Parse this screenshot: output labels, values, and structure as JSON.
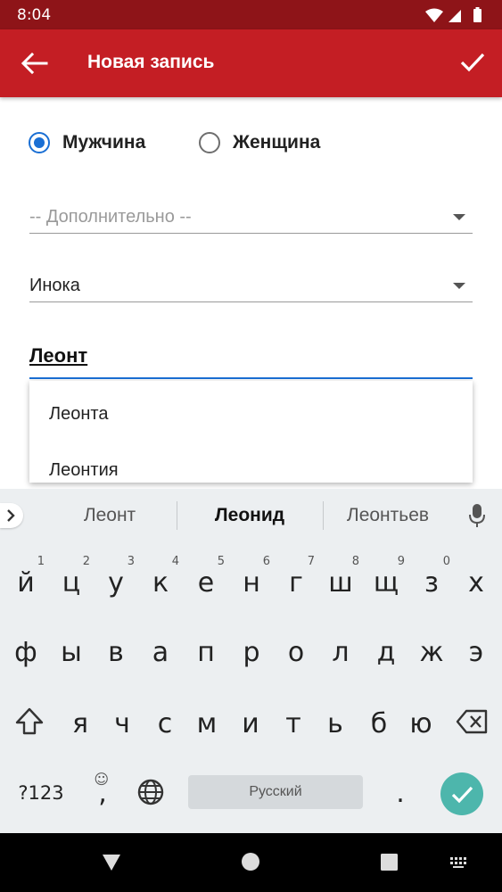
{
  "status": {
    "time": "8:04"
  },
  "toolbar": {
    "title": "Новая запись"
  },
  "gender": {
    "male": "Мужчина",
    "female": "Женщина",
    "selected": "male"
  },
  "fields": {
    "extra_placeholder": "-- Дополнительно --",
    "status_value": "Инока",
    "name_value": "Леонт"
  },
  "dropdown": {
    "items": [
      "Леонта",
      "Леонтия"
    ]
  },
  "keyboard": {
    "suggestions": [
      "Леонт",
      "Леонид",
      "Леонтьев"
    ],
    "row1": [
      "й",
      "ц",
      "у",
      "к",
      "е",
      "н",
      "г",
      "ш",
      "щ",
      "з",
      "х"
    ],
    "row1_hints": [
      "1",
      "2",
      "3",
      "4",
      "5",
      "6",
      "7",
      "8",
      "9",
      "0",
      ""
    ],
    "row2": [
      "ф",
      "ы",
      "в",
      "а",
      "п",
      "р",
      "о",
      "л",
      "д",
      "ж",
      "э"
    ],
    "row3": [
      "я",
      "ч",
      "с",
      "м",
      "и",
      "т",
      "ь",
      "б",
      "ю"
    ],
    "symbols_label": "?123",
    "comma": ",",
    "emoji_hint": "☺",
    "space_label": "Русский",
    "period": "."
  },
  "colors": {
    "accent": "#c41e24",
    "status_bar": "#8e1418",
    "input_focus": "#1a6fd4",
    "enter": "#4db6ac"
  }
}
